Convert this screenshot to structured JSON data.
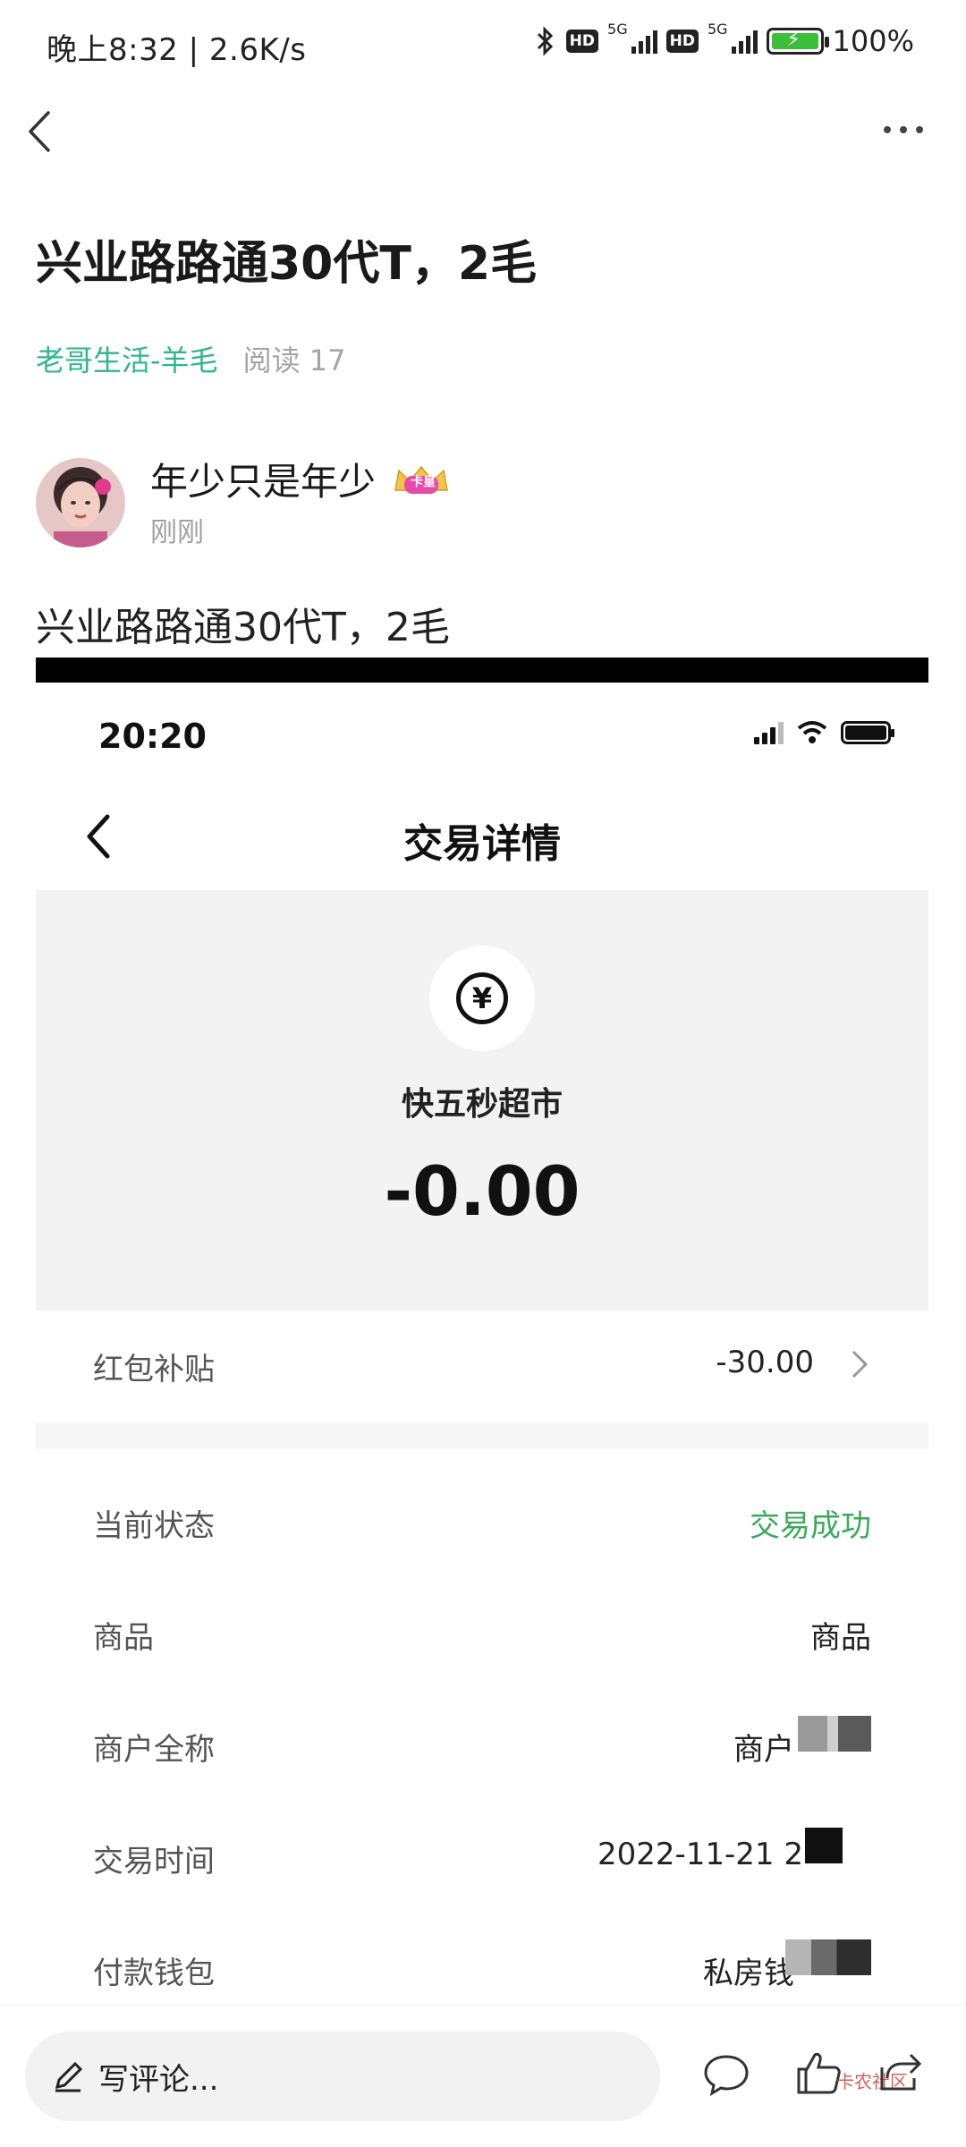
{
  "status_bar": {
    "left_text": "晚上8:32 | 2.6K/s",
    "hd_label": "HD",
    "net_label": "5G",
    "battery_text": "100%"
  },
  "post": {
    "title": "兴业路路通30代T，2毛",
    "category": "老哥生活-羊毛",
    "reads": "阅读 17",
    "author_name": "年少只是年少",
    "author_badge": "卡皇",
    "time": "刚刚",
    "body": "兴业路路通30代T，2毛"
  },
  "screenshot": {
    "time": "20:20",
    "page_title": "交易详情",
    "merchant": "快五秒超市",
    "amount": "-0.00",
    "subsidy_label": "红包补贴",
    "subsidy_value": "-30.00",
    "rows": [
      {
        "label": "当前状态",
        "value": "交易成功"
      },
      {
        "label": "商品",
        "value": "商品"
      },
      {
        "label": "商户全称",
        "value": "商户"
      },
      {
        "label": "交易时间",
        "value": "2022-11-21 2"
      },
      {
        "label": "付款钱包",
        "value": "私房钱"
      }
    ]
  },
  "bottom_bar": {
    "comment_placeholder": "写评论...",
    "watermark": "卡农社区"
  },
  "colors": {
    "accent_green": "#2fb68f",
    "success_green": "#3aab5a"
  }
}
